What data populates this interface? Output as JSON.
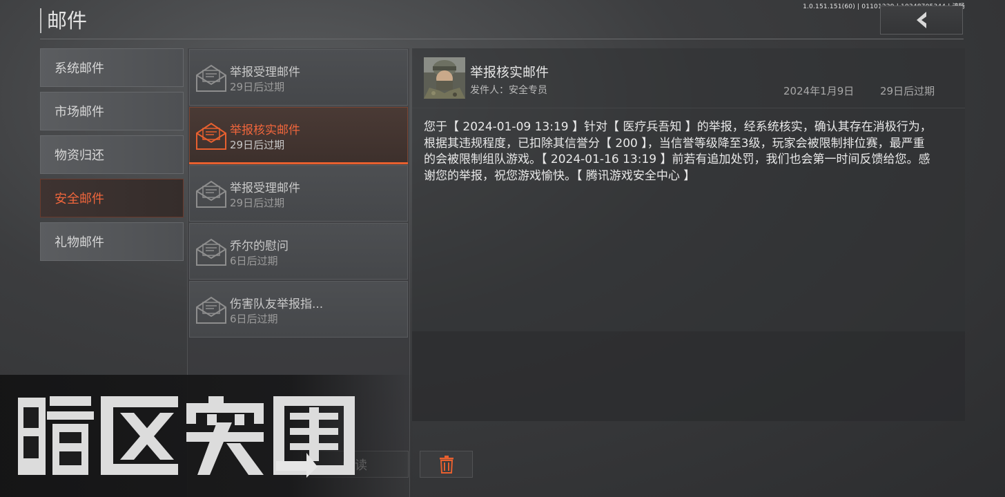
{
  "version": "1.0.151.151(60) | 01101229 | 10348705344 | 流畅",
  "page_title": "邮件",
  "categories": [
    {
      "label": "系统邮件",
      "active": false
    },
    {
      "label": "市场邮件",
      "active": false
    },
    {
      "label": "物资归还",
      "active": false
    },
    {
      "label": "安全邮件",
      "active": true
    },
    {
      "label": "礼物邮件",
      "active": false
    }
  ],
  "mails": [
    {
      "title": "举报受理邮件",
      "expire": "29日后过期",
      "active": false
    },
    {
      "title": "举报核实邮件",
      "expire": "29日后过期",
      "active": true
    },
    {
      "title": "举报受理邮件",
      "expire": "29日后过期",
      "active": false
    },
    {
      "title": "乔尔的慰问",
      "expire": "6日后过期",
      "active": false
    },
    {
      "title": "伤害队友举报指...",
      "expire": "6日后过期",
      "active": false
    }
  ],
  "detail": {
    "title": "举报核实邮件",
    "sender": "发件人：安全专员",
    "date": "2024年1月9日",
    "expire": "29日后过期",
    "body": "您于【 2024-01-09 13:19 】针对【 医疗兵吾知 】的举报，经系统核实，确认其存在消极行为，根据其违规程度，已扣除其信誉分【 200 】，当信誉等级降至3级，玩家会被限制排位赛，最严重的会被限制组队游戏。【 2024-01-16 13:19 】前若有追加处罚，我们也会第一时间反馈给您。感谢您的举报，祝您游戏愉快。【 腾讯游戏安全中心 】"
  },
  "buttons": {
    "read_label": "阅读"
  },
  "logo_text": "暗区突围",
  "colors": {
    "accent": "#f0663c",
    "accent_bar": "#e8602f"
  },
  "icons": {
    "back": "chevron-left-icon",
    "mail": "envelope-open-icon",
    "delete": "trash-icon"
  }
}
